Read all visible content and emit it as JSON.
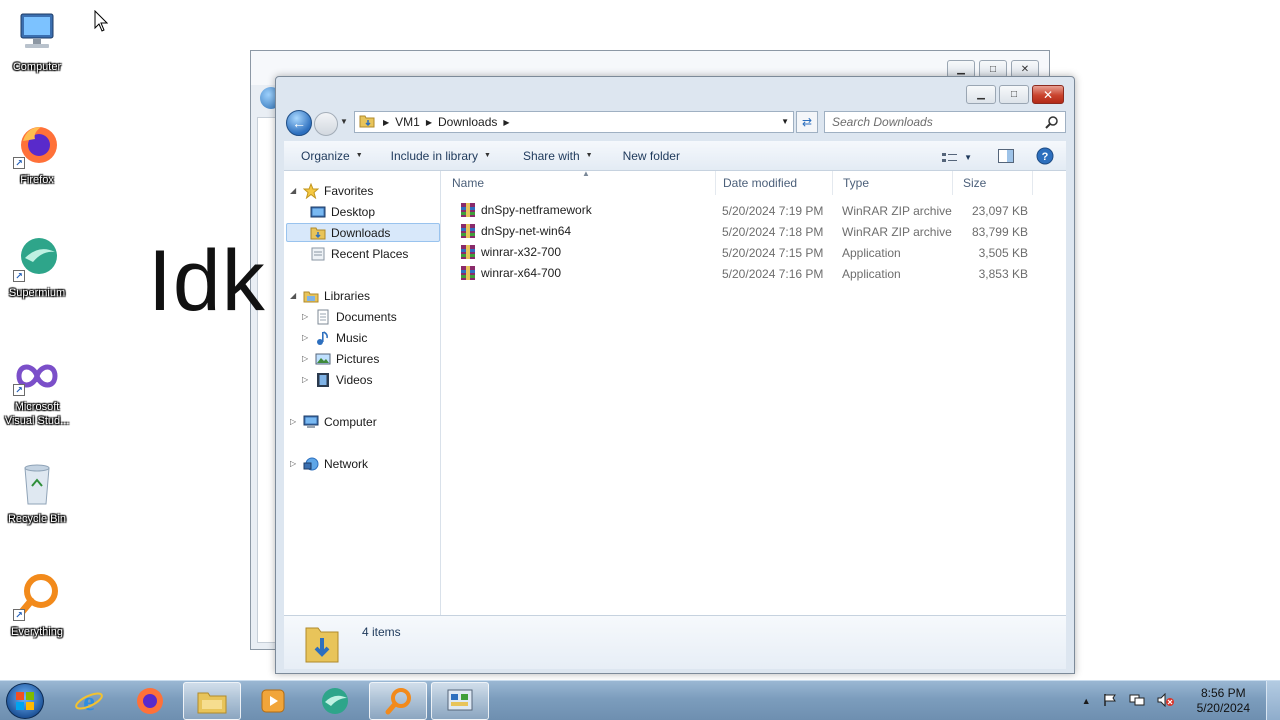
{
  "desktop": {
    "icons": [
      {
        "label": "Computer",
        "icon": "computer-icon"
      },
      {
        "label": "Firefox",
        "icon": "firefox-icon"
      },
      {
        "label": "Supermium",
        "icon": "supermium-icon"
      },
      {
        "label": "Microsoft Visual Stud...",
        "icon": "visual-studio-icon"
      },
      {
        "label": "Recycle Bin",
        "icon": "recycle-bin-icon"
      },
      {
        "label": "Everything",
        "icon": "everything-search-icon"
      }
    ],
    "background_window_text": "Idk"
  },
  "explorer": {
    "address": {
      "crumbs": [
        "VM1",
        "Downloads"
      ]
    },
    "search_placeholder": "Search Downloads",
    "toolbar": {
      "organize": "Organize",
      "include_in_library": "Include in library",
      "share_with": "Share with",
      "new_folder": "New folder"
    },
    "nav": {
      "favorites": "Favorites",
      "desktop": "Desktop",
      "downloads": "Downloads",
      "recent_places": "Recent Places",
      "libraries": "Libraries",
      "documents": "Documents",
      "music": "Music",
      "pictures": "Pictures",
      "videos": "Videos",
      "computer": "Computer",
      "network": "Network",
      "selected": "Downloads"
    },
    "columns": {
      "name": "Name",
      "date_modified": "Date modified",
      "type": "Type",
      "size": "Size"
    },
    "files": [
      {
        "name": "dnSpy-netframework",
        "date": "5/20/2024 7:19 PM",
        "type": "WinRAR ZIP archive",
        "size": "23,097 KB"
      },
      {
        "name": "dnSpy-net-win64",
        "date": "5/20/2024 7:18 PM",
        "type": "WinRAR ZIP archive",
        "size": "83,799 KB"
      },
      {
        "name": "winrar-x32-700",
        "date": "5/20/2024 7:15 PM",
        "type": "Application",
        "size": "3,505 KB"
      },
      {
        "name": "winrar-x64-700",
        "date": "5/20/2024 7:16 PM",
        "type": "Application",
        "size": "3,853 KB"
      }
    ],
    "status_count": "4 items"
  },
  "taskbar": {
    "apps": [
      "internet-explorer-icon",
      "firefox-icon",
      "file-explorer-icon",
      "media-player-icon",
      "supermium-icon",
      "everything-search-icon",
      "control-panel-icon"
    ],
    "clock_time": "8:56 PM",
    "clock_date": "5/20/2024"
  },
  "colors": {
    "selection": "#d8e8fa",
    "taskbar": "#7c9dbd",
    "accent_blue": "#2d6fbe"
  }
}
